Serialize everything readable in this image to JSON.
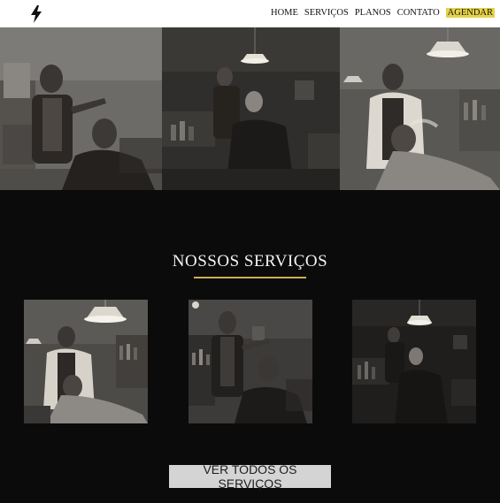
{
  "nav": {
    "logo_icon": "lightning-bolt-icon",
    "links": [
      "HOME",
      "SERVIÇOS",
      "PLANOS",
      "CONTATO",
      "AGENDAR"
    ],
    "accent_color": "#e6d24a"
  },
  "hero": {
    "images": [
      "barber-cutting-hair-photo",
      "barber-trimming-older-client-photo",
      "barber-shaving-client-photo"
    ]
  },
  "services": {
    "title": "NOSSOS SERVIÇOS",
    "underline_color": "#cfae55",
    "cards": [
      "barber-shaving-client-photo",
      "barber-cutting-hair-photo",
      "barber-trimming-older-client-photo"
    ],
    "button_label": "VER TODOS OS SERVIÇOS"
  }
}
